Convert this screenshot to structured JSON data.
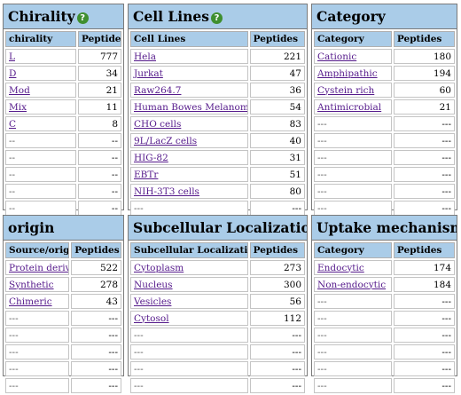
{
  "panels": [
    {
      "title": "Chirality",
      "help": true,
      "col1": "chirality",
      "col2": "Peptides",
      "rows": [
        {
          "label": "L",
          "value": "777",
          "link": true
        },
        {
          "label": "D",
          "value": "34",
          "link": true
        },
        {
          "label": "Mod",
          "value": "21",
          "link": true
        },
        {
          "label": "Mix",
          "value": "11",
          "link": true
        },
        {
          "label": "C",
          "value": "8",
          "link": true
        },
        {
          "label": "--",
          "value": "--",
          "link": false
        },
        {
          "label": "--",
          "value": "--",
          "link": false
        },
        {
          "label": "--",
          "value": "--",
          "link": false
        },
        {
          "label": "--",
          "value": "--",
          "link": false
        },
        {
          "label": "--",
          "value": "--",
          "link": false
        }
      ]
    },
    {
      "title": "Cell Lines",
      "help": true,
      "col1": "Cell Lines",
      "col2": "Peptides",
      "rows": [
        {
          "label": "Hela",
          "value": "221",
          "link": true
        },
        {
          "label": "Jurkat",
          "value": "47",
          "link": true
        },
        {
          "label": "Raw264.7",
          "value": "36",
          "link": true
        },
        {
          "label": "Human Bowes Melanoma",
          "value": "54",
          "link": true
        },
        {
          "label": "CHO cells",
          "value": "83",
          "link": true
        },
        {
          "label": "9L/LacZ cells",
          "value": "40",
          "link": true
        },
        {
          "label": "HIG-82",
          "value": "31",
          "link": true
        },
        {
          "label": "EBTr",
          "value": "51",
          "link": true
        },
        {
          "label": "NIH-3T3 cells",
          "value": "80",
          "link": true
        },
        {
          "label": "---",
          "value": "---",
          "link": false
        }
      ]
    },
    {
      "title": "Category",
      "help": false,
      "col1": "Category",
      "col2": "Peptides",
      "rows": [
        {
          "label": "Cationic",
          "value": "180",
          "link": true
        },
        {
          "label": "Amphipathic",
          "value": "194",
          "link": true
        },
        {
          "label": "Cystein rich",
          "value": "60",
          "link": true
        },
        {
          "label": "Antimicrobial",
          "value": "21",
          "link": true
        },
        {
          "label": "---",
          "value": "---",
          "link": false
        },
        {
          "label": "---",
          "value": "---",
          "link": false
        },
        {
          "label": "---",
          "value": "---",
          "link": false
        },
        {
          "label": "---",
          "value": "---",
          "link": false
        },
        {
          "label": "---",
          "value": "---",
          "link": false
        },
        {
          "label": "---",
          "value": "---",
          "link": false
        }
      ]
    },
    {
      "title": "origin",
      "help": false,
      "col1": "Source/origin",
      "col2": "Peptides",
      "rows": [
        {
          "label": "Protein derived",
          "value": "522",
          "link": true
        },
        {
          "label": "Synthetic",
          "value": "278",
          "link": true
        },
        {
          "label": "Chimeric",
          "value": "43",
          "link": true
        },
        {
          "label": "---",
          "value": "---",
          "link": false
        },
        {
          "label": "---",
          "value": "---",
          "link": false
        },
        {
          "label": "---",
          "value": "---",
          "link": false
        },
        {
          "label": "---",
          "value": "---",
          "link": false
        },
        {
          "label": "---",
          "value": "---",
          "link": false
        }
      ]
    },
    {
      "title": "Subcellular Localization",
      "help": false,
      "col1": "Subcellular Localization",
      "col2": "Peptides",
      "rows": [
        {
          "label": "Cytoplasm",
          "value": "273",
          "link": true
        },
        {
          "label": "Nucleus",
          "value": "300",
          "link": true
        },
        {
          "label": "Vesicles",
          "value": "56",
          "link": true
        },
        {
          "label": "Cytosol",
          "value": "112",
          "link": true
        },
        {
          "label": "---",
          "value": "---",
          "link": false
        },
        {
          "label": "---",
          "value": "---",
          "link": false
        },
        {
          "label": "---",
          "value": "---",
          "link": false
        },
        {
          "label": "---",
          "value": "---",
          "link": false
        }
      ]
    },
    {
      "title": "Uptake mechanism",
      "help": false,
      "col1": "Category",
      "col2": "Peptides",
      "rows": [
        {
          "label": "Endocytic",
          "value": "174",
          "link": true
        },
        {
          "label": "Non-endocytic",
          "value": "184",
          "link": true
        },
        {
          "label": "---",
          "value": "---",
          "link": false
        },
        {
          "label": "---",
          "value": "---",
          "link": false
        },
        {
          "label": "---",
          "value": "---",
          "link": false
        },
        {
          "label": "---",
          "value": "---",
          "link": false
        },
        {
          "label": "---",
          "value": "---",
          "link": false
        },
        {
          "label": "---",
          "value": "---",
          "link": false
        }
      ]
    }
  ],
  "help_icon": "help-question-icon",
  "colors": {
    "header_bg": "#aacce8",
    "link": "#551a8b",
    "help_icon": "#3f8f2f"
  }
}
